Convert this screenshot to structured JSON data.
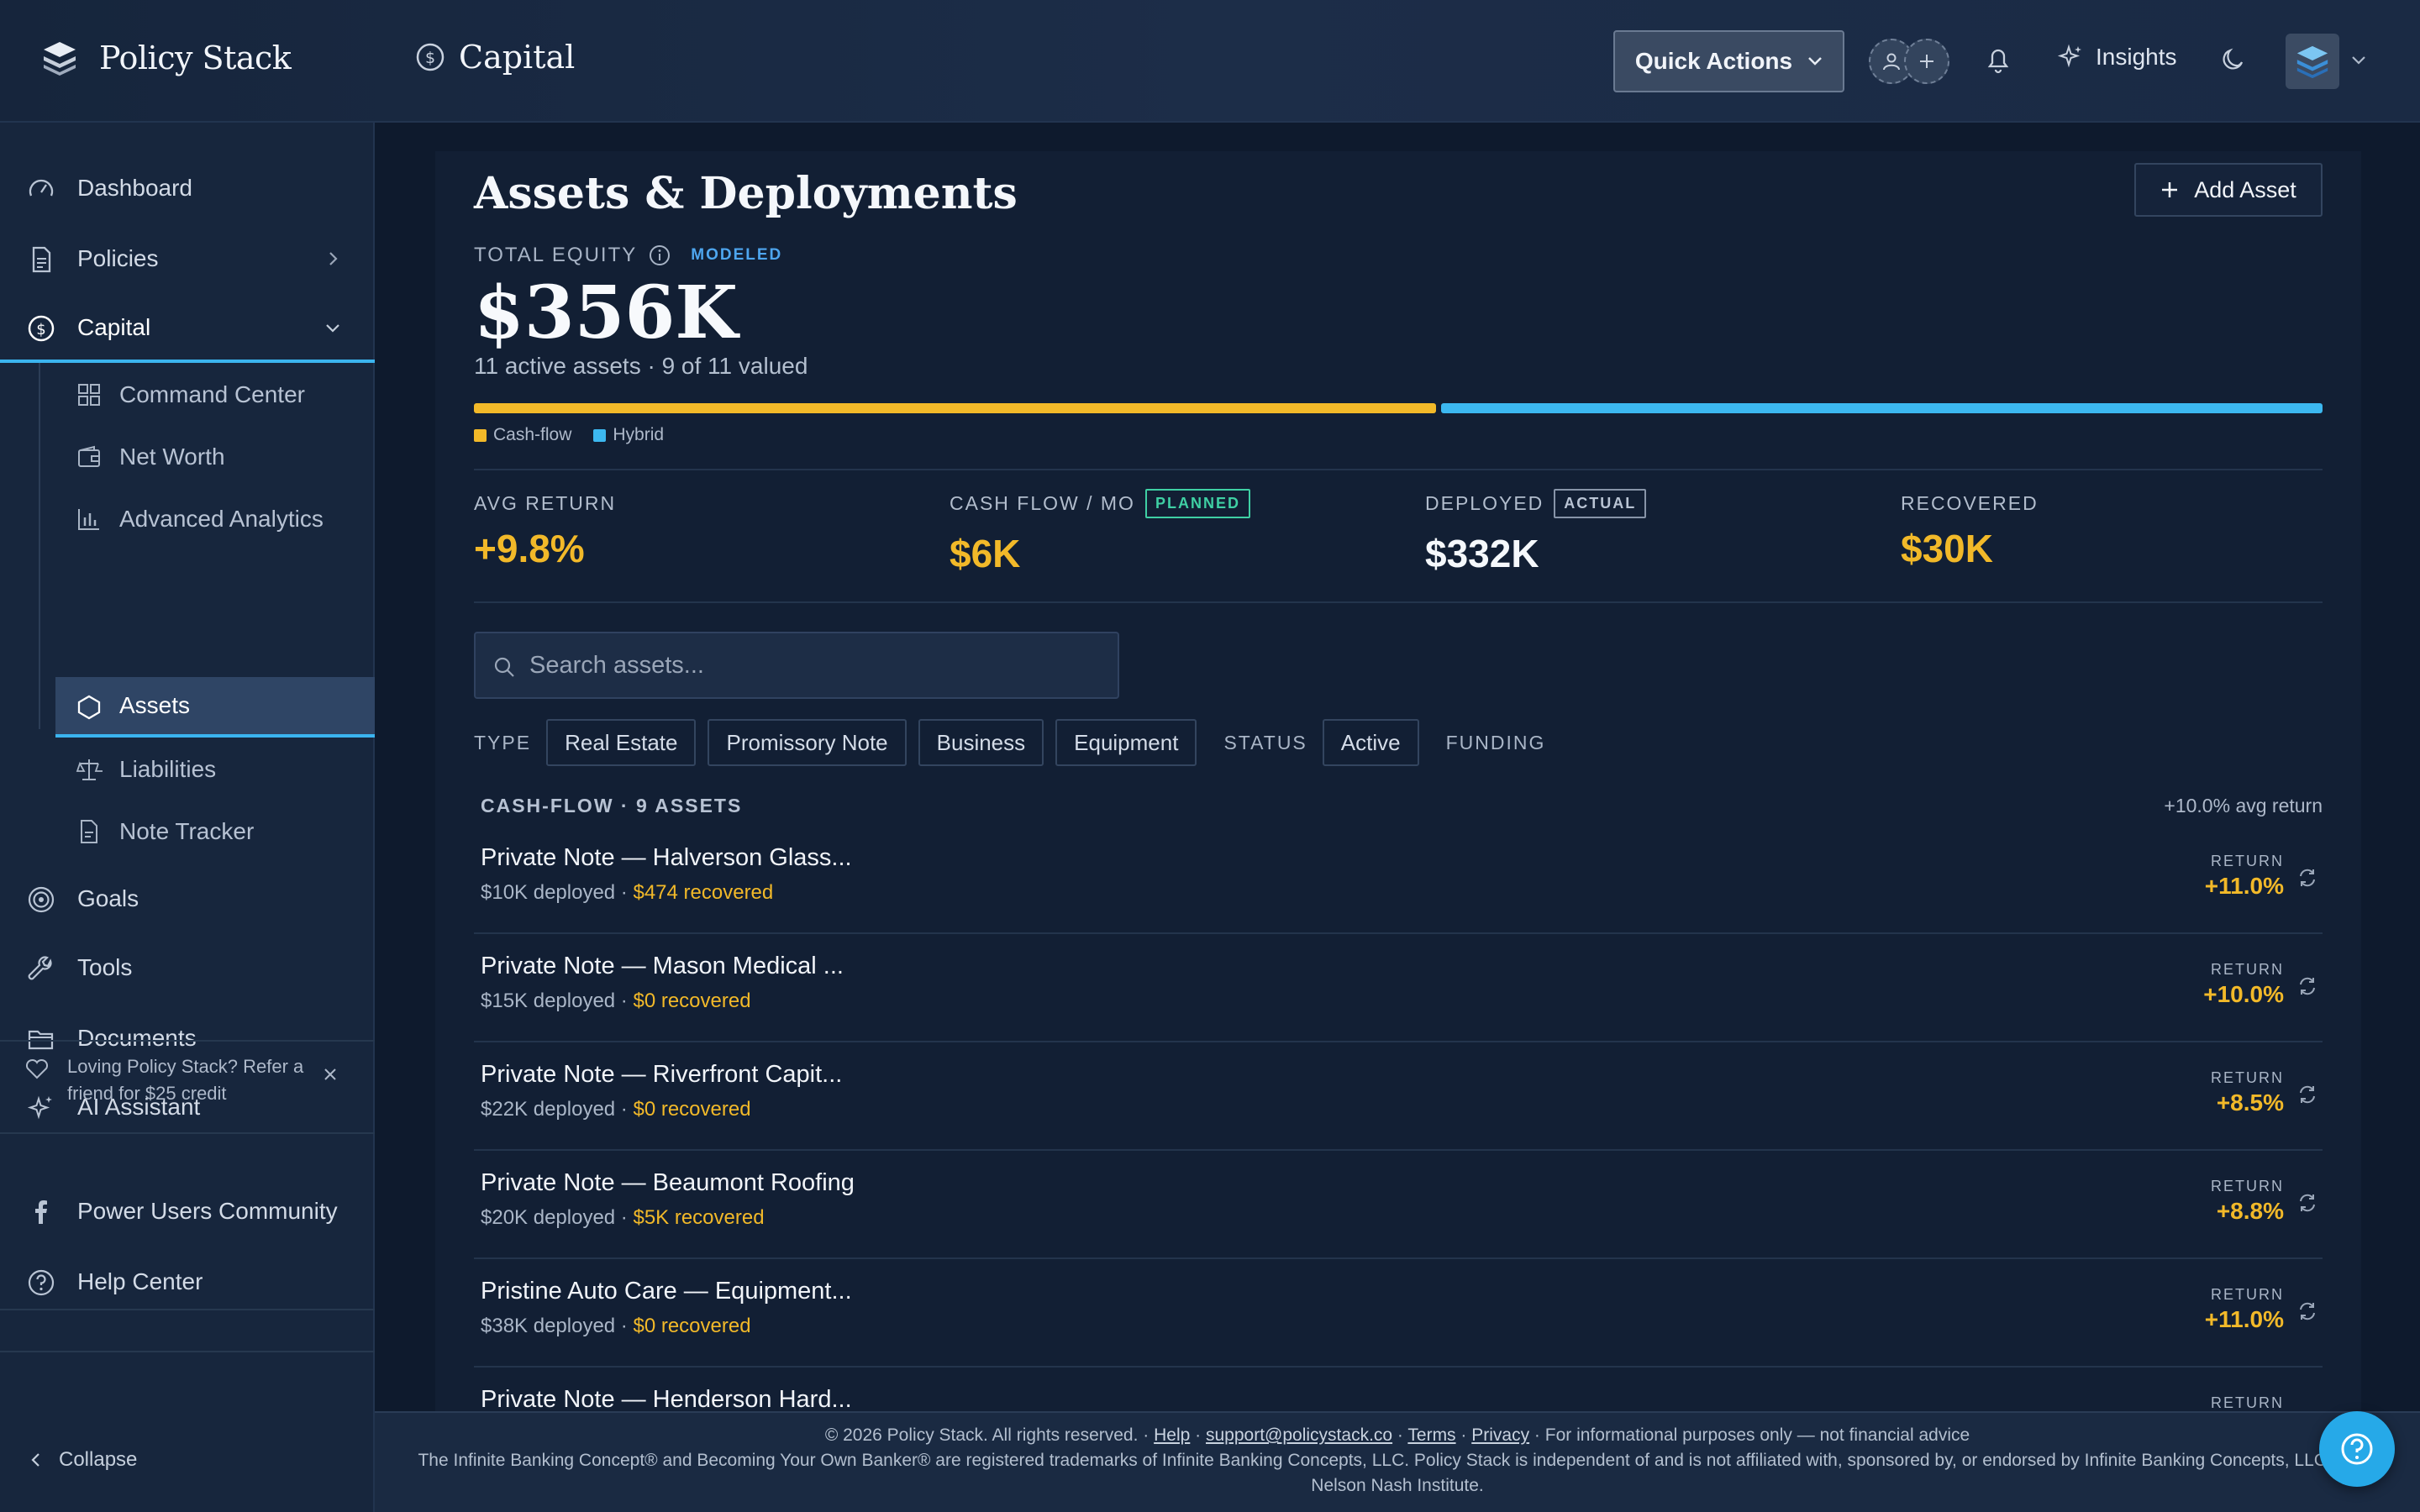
{
  "app": {
    "name": "Policy Stack",
    "section": "Capital"
  },
  "header": {
    "quick_actions": "Quick Actions",
    "insights": "Insights"
  },
  "sidebar": {
    "items": [
      {
        "label": "Dashboard",
        "icon": "gauge-icon"
      },
      {
        "label": "Policies",
        "icon": "document-icon"
      },
      {
        "label": "Capital",
        "icon": "dollar-circle-icon"
      }
    ],
    "capital_sub": [
      {
        "label": "Command Center",
        "icon": "grid-icon"
      },
      {
        "label": "Net Worth",
        "icon": "wallet-icon"
      },
      {
        "label": "Advanced Analytics",
        "icon": "bar-chart-icon"
      },
      {
        "label": "Assets",
        "icon": "hexagon-icon"
      },
      {
        "label": "Liabilities",
        "icon": "scale-icon"
      },
      {
        "label": "Note Tracker",
        "icon": "note-icon"
      }
    ],
    "items_lower": [
      {
        "label": "Goals",
        "icon": "target-icon"
      },
      {
        "label": "Tools",
        "icon": "wrench-icon"
      },
      {
        "label": "Documents",
        "icon": "folder-icon"
      },
      {
        "label": "AI Assistant",
        "icon": "sparkles-icon"
      }
    ],
    "referral": "Loving Policy Stack? Refer a friend for $25 credit",
    "community": [
      {
        "label": "Power Users Community",
        "icon": "facebook-icon"
      },
      {
        "label": "Help Center",
        "icon": "question-circle-icon"
      }
    ],
    "collapse": "Collapse"
  },
  "page": {
    "title": "Assets & Deployments",
    "add_asset": "Add Asset",
    "equity_label": "TOTAL EQUITY",
    "equity_tag": "MODELED",
    "equity_value": "$356K",
    "equity_sub": "11 active assets · 9 of 11 valued",
    "split": [
      {
        "label": "Cash-flow",
        "color": "#f2b929",
        "share": 0.522
      },
      {
        "label": "Hybrid",
        "color": "#3cb8f0",
        "share": 0.478
      }
    ],
    "stats": [
      {
        "label": "AVG RETURN",
        "value": "+9.8%",
        "tag": ""
      },
      {
        "label": "CASH FLOW / MO",
        "value": "$6K",
        "tag": "PLANNED"
      },
      {
        "label": "DEPLOYED",
        "value": "$332K",
        "tag": "ACTUAL"
      },
      {
        "label": "RECOVERED",
        "value": "$30K",
        "tag": ""
      }
    ],
    "search_placeholder": "Search assets...",
    "filters": {
      "type_label": "TYPE",
      "types": [
        "Real Estate",
        "Promissory Note",
        "Business",
        "Equipment"
      ],
      "status_label": "STATUS",
      "statuses": [
        "Active"
      ],
      "funding_label": "FUNDING"
    },
    "group": {
      "title": "CASH-FLOW · 9 ASSETS",
      "meta": "+10.0% avg return"
    },
    "return_label": "RETURN",
    "assets": [
      {
        "name": "Private Note — Halverson Glass...",
        "deployed": "$10K deployed · ",
        "recovered": "$474 recovered",
        "return": "+11.0%"
      },
      {
        "name": "Private Note — Mason Medical ...",
        "deployed": "$15K deployed · ",
        "recovered": "$0 recovered",
        "return": "+10.0%"
      },
      {
        "name": "Private Note — Riverfront Capit...",
        "deployed": "$22K deployed · ",
        "recovered": "$0 recovered",
        "return": "+8.5%"
      },
      {
        "name": "Private Note — Beaumont Roofing",
        "deployed": "$20K deployed · ",
        "recovered": "$5K recovered",
        "return": "+8.8%"
      },
      {
        "name": "Pristine Auto Care — Equipment...",
        "deployed": "$38K deployed · ",
        "recovered": "$0 recovered",
        "return": "+11.0%"
      },
      {
        "name": "Private Note — Henderson Hard...",
        "deployed": "",
        "recovered": "",
        "return": ""
      }
    ]
  },
  "footer": {
    "copyright": "© 2026 Policy Stack. All rights reserved. · ",
    "help": "Help",
    "email": "support@policystack.co",
    "terms": "Terms",
    "privacy": "Privacy",
    "disclaimer": " · For informational purposes only — not financial advice",
    "trademark": "The Infinite Banking Concept® and Becoming Your Own Banker® are registered trademarks of Infinite Banking Concepts, LLC. Policy Stack is independent of and is not affiliated with, sponsored by, or endorsed by Infinite Banking Concepts, LLC or the Nelson Nash Institute."
  },
  "colors": {
    "accent": "#3cb8f0",
    "gold": "#f2b929",
    "background": "#0e1a2d"
  }
}
